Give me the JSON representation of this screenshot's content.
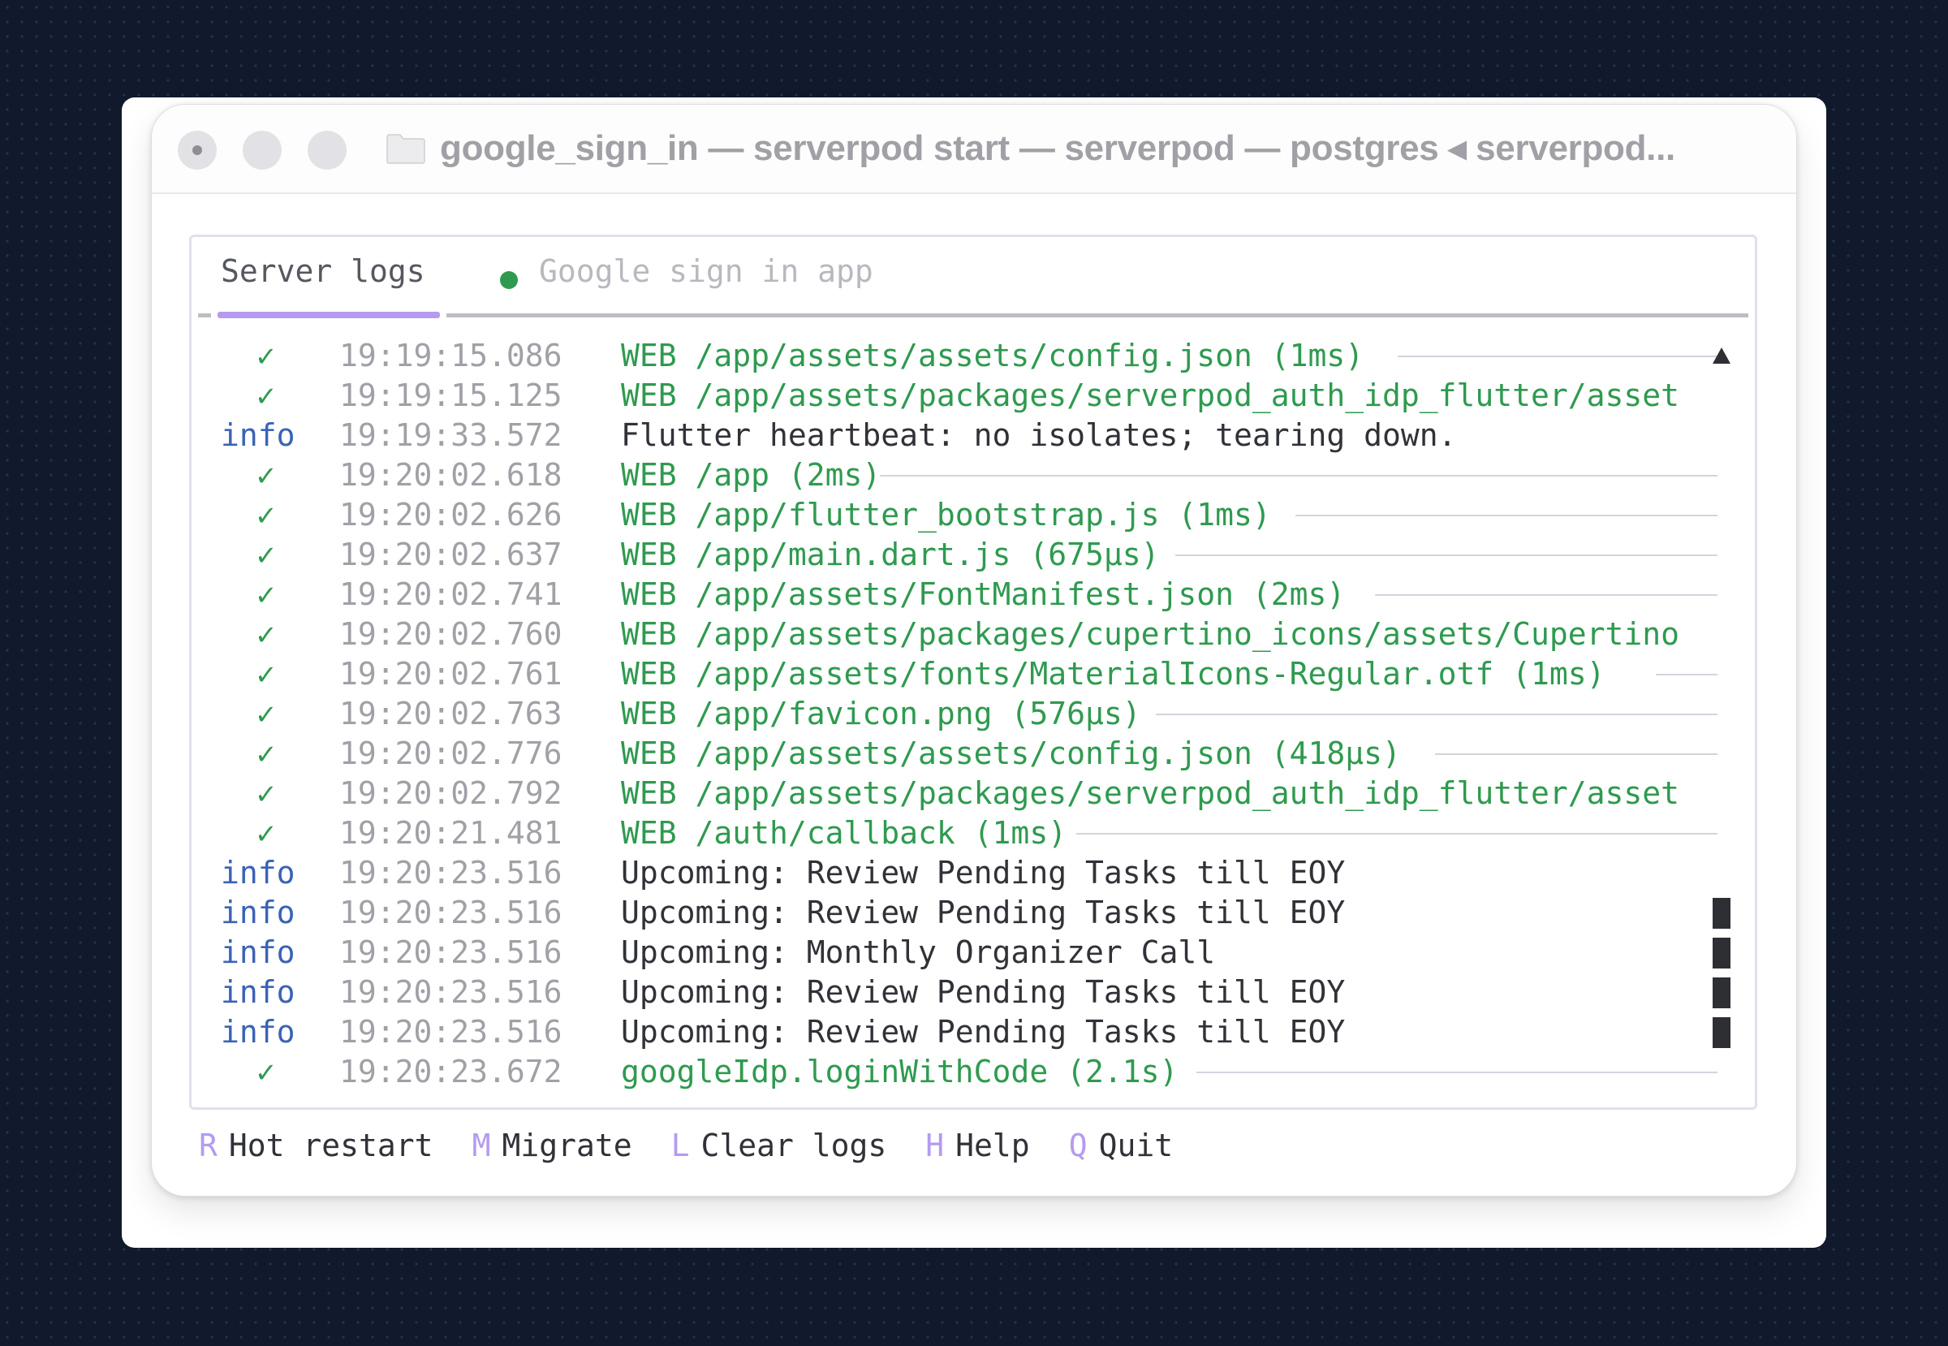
{
  "window": {
    "title": "google_sign_in — serverpod start — serverpod — postgres ◂ serverpod..."
  },
  "tabs": [
    {
      "label": "Server logs",
      "active": true
    },
    {
      "label": "Google sign in app",
      "active": false,
      "status_color": "#2f9a4f"
    }
  ],
  "logs": [
    {
      "level": "✓",
      "time": "19:19:15.086",
      "message": "WEB /app/assets/assets/config.json (1ms)"
    },
    {
      "level": "✓",
      "time": "19:19:15.125",
      "message": "WEB /app/assets/packages/serverpod_auth_idp_flutter/asset"
    },
    {
      "level": "info",
      "time": "19:19:33.572",
      "message": "Flutter heartbeat: no isolates; tearing down."
    },
    {
      "level": "✓",
      "time": "19:20:02.618",
      "message": "WEB /app (2ms)"
    },
    {
      "level": "✓",
      "time": "19:20:02.626",
      "message": "WEB /app/flutter_bootstrap.js (1ms)"
    },
    {
      "level": "✓",
      "time": "19:20:02.637",
      "message": "WEB /app/main.dart.js (675µs)"
    },
    {
      "level": "✓",
      "time": "19:20:02.741",
      "message": "WEB /app/assets/FontManifest.json (2ms)"
    },
    {
      "level": "✓",
      "time": "19:20:02.760",
      "message": "WEB /app/assets/packages/cupertino_icons/assets/Cupertino"
    },
    {
      "level": "✓",
      "time": "19:20:02.761",
      "message": "WEB /app/assets/fonts/MaterialIcons-Regular.otf (1ms)"
    },
    {
      "level": "✓",
      "time": "19:20:02.763",
      "message": "WEB /app/favicon.png (576µs)"
    },
    {
      "level": "✓",
      "time": "19:20:02.776",
      "message": "WEB /app/assets/assets/config.json (418µs)"
    },
    {
      "level": "✓",
      "time": "19:20:02.792",
      "message": "WEB /app/assets/packages/serverpod_auth_idp_flutter/asset"
    },
    {
      "level": "✓",
      "time": "19:20:21.481",
      "message": "WEB /auth/callback (1ms)"
    },
    {
      "level": "info",
      "time": "19:20:23.516",
      "message": "Upcoming: Review Pending Tasks till EOY"
    },
    {
      "level": "info",
      "time": "19:20:23.516",
      "message": "Upcoming: Review Pending Tasks till EOY"
    },
    {
      "level": "info",
      "time": "19:20:23.516",
      "message": "Upcoming: Monthly Organizer Call"
    },
    {
      "level": "info",
      "time": "19:20:23.516",
      "message": "Upcoming: Review Pending Tasks till EOY"
    },
    {
      "level": "info",
      "time": "19:20:23.516",
      "message": "Upcoming: Review Pending Tasks till EOY"
    },
    {
      "level": "✓",
      "time": "19:20:23.672",
      "message": "googleIdp.loginWithCode (2.1s)"
    }
  ],
  "footer": [
    {
      "key": "R",
      "label": "Hot restart"
    },
    {
      "key": "M",
      "label": "Migrate"
    },
    {
      "key": "L",
      "label": "Clear logs"
    },
    {
      "key": "H",
      "label": "Help"
    },
    {
      "key": "Q",
      "label": "Quit"
    }
  ],
  "colors": {
    "success": "#2f9a4f",
    "info": "#3b63b5",
    "accent": "#b49bf0",
    "timestamp": "#a0a1a7"
  }
}
